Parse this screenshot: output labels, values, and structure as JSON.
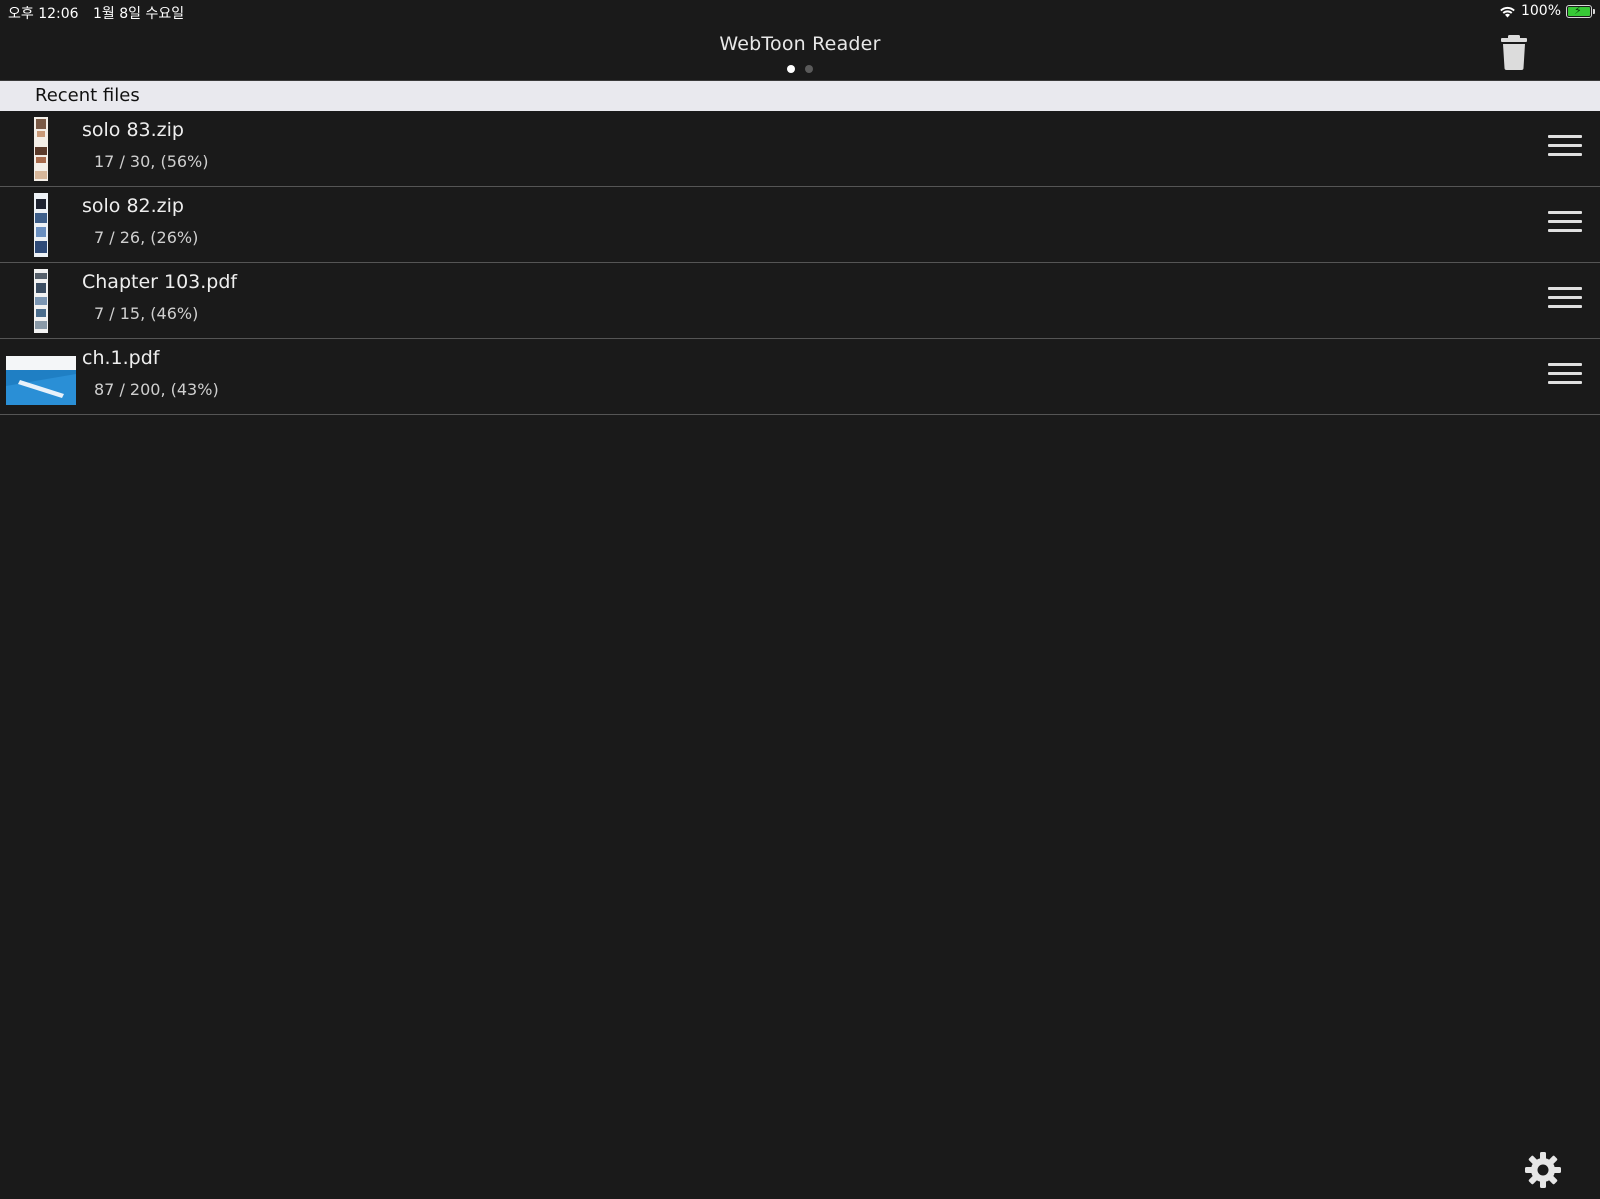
{
  "status_bar": {
    "time": "오후 12:06",
    "date": "1월 8일 수요일",
    "battery": "100%",
    "battery_level": 1.0,
    "battery_color": "#37c936"
  },
  "nav": {
    "title": "WebToon Reader",
    "trash_icon": "trash-icon",
    "page_count": 2,
    "active_page": 0
  },
  "section": {
    "title": "Recent files"
  },
  "files": [
    {
      "name": "solo 83.zip",
      "progress": "17 / 30, (56%)",
      "thumb": "tall"
    },
    {
      "name": "solo 82.zip",
      "progress": "7 / 26, (26%)",
      "thumb": "tall"
    },
    {
      "name": "Chapter 103.pdf",
      "progress": "7 / 15, (46%)",
      "thumb": "tall"
    },
    {
      "name": "ch.1.pdf",
      "progress": "87 / 200, (43%)",
      "thumb": "wide"
    }
  ],
  "settings": {
    "icon": "gear-icon"
  }
}
